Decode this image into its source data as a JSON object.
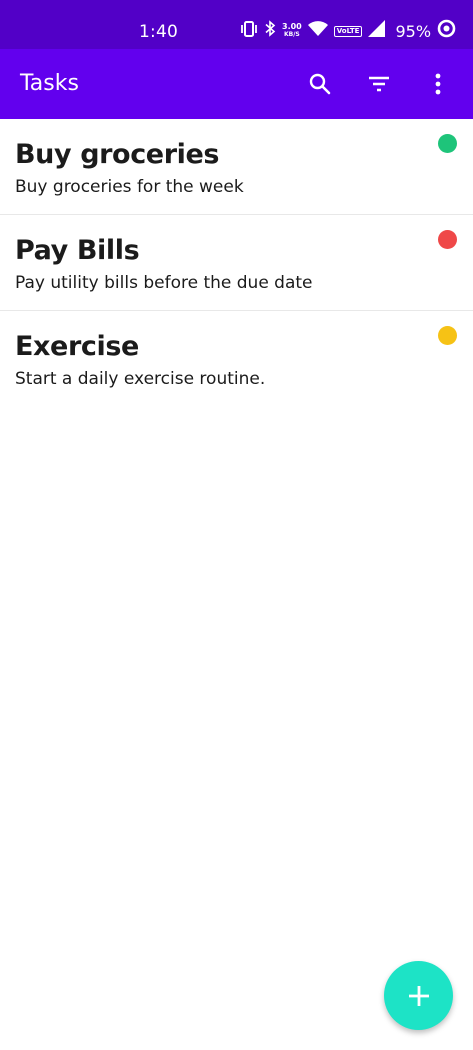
{
  "status_bar": {
    "time": "1:40",
    "net_speed_value": "3.00",
    "net_speed_unit": "KB/S",
    "volte": "VoLTE",
    "battery": "95%",
    "icons": [
      "vibrate-icon",
      "bluetooth-icon",
      "wifi-icon",
      "signal-icon",
      "battery-ring-icon"
    ]
  },
  "app_bar": {
    "title": "Tasks",
    "background": "#6200ee",
    "actions": [
      "search-icon",
      "filter-icon",
      "more-vert-icon"
    ]
  },
  "tasks": [
    {
      "title": "Buy groceries",
      "description": "Buy groceries for the week",
      "priority_color": "#1ec47a"
    },
    {
      "title": "Pay Bills",
      "description": "Pay utility bills before the due date",
      "priority_color": "#ef4848"
    },
    {
      "title": "Exercise",
      "description": "Start a daily exercise routine.",
      "priority_color": "#f6c215"
    }
  ],
  "fab": {
    "icon": "add-icon",
    "color": "#1de3c6"
  }
}
